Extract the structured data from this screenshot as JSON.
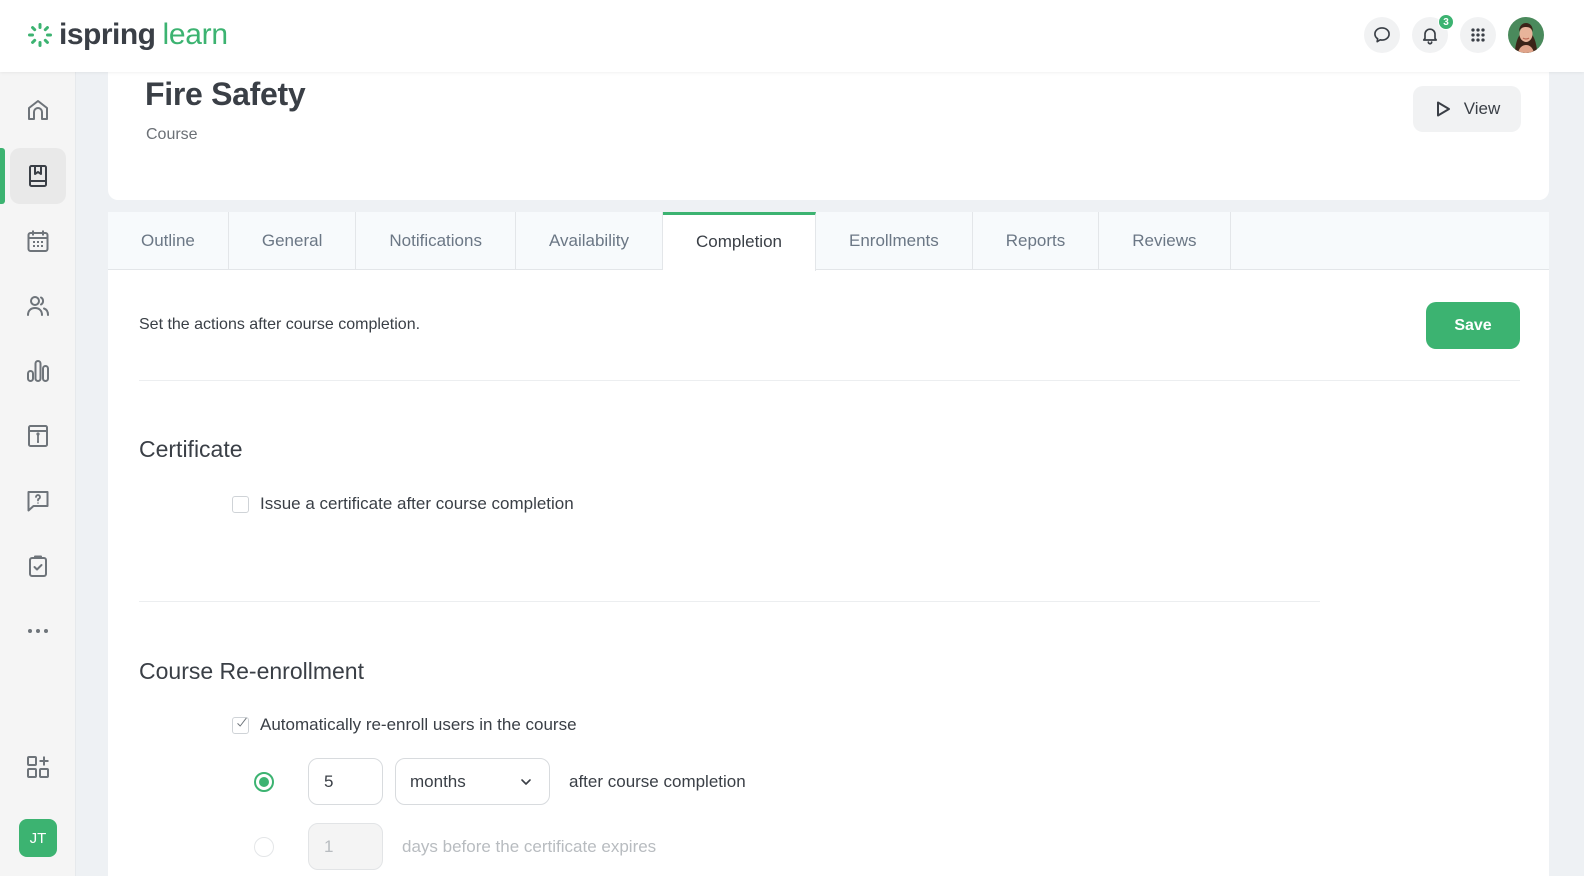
{
  "app": {
    "logo_primary": "ispring",
    "logo_secondary": "learn",
    "brand_color": "#3cb371"
  },
  "topbar": {
    "chat_icon": "chat-bubble-icon",
    "notifications_icon": "bell-icon",
    "notifications_count": "3",
    "apps_icon": "grid-dots-icon",
    "user_avatar": "user-avatar-photo"
  },
  "sidebar": {
    "items": [
      {
        "icon": "home-icon",
        "active": false
      },
      {
        "icon": "book-icon",
        "active": true
      },
      {
        "icon": "calendar-icon",
        "active": false
      },
      {
        "icon": "users-icon",
        "active": false
      },
      {
        "icon": "bar-chart-icon",
        "active": false
      },
      {
        "icon": "info-board-icon",
        "active": false
      },
      {
        "icon": "question-chat-icon",
        "active": false
      },
      {
        "icon": "clipboard-check-icon",
        "active": false
      },
      {
        "icon": "more-dots-icon",
        "active": false
      }
    ],
    "add_widget_icon": "add-apps-icon",
    "user_initials": "JT"
  },
  "header": {
    "title": "Fire Safety",
    "subtitle": "Course",
    "view_label": "View"
  },
  "tabs": [
    {
      "label": "Outline",
      "active": false
    },
    {
      "label": "General",
      "active": false
    },
    {
      "label": "Notifications",
      "active": false
    },
    {
      "label": "Availability",
      "active": false
    },
    {
      "label": "Completion",
      "active": true
    },
    {
      "label": "Enrollments",
      "active": false
    },
    {
      "label": "Reports",
      "active": false
    },
    {
      "label": "Reviews",
      "active": false
    }
  ],
  "completion": {
    "intro": "Set the actions after course completion.",
    "save_label": "Save",
    "certificate": {
      "title": "Certificate",
      "issue_label": "Issue a certificate after course completion",
      "issue_checked": false
    },
    "reenrollment": {
      "title": "Course Re-enrollment",
      "auto_label": "Automatically re-enroll users in the course",
      "auto_checked": true,
      "option_after": {
        "selected": true,
        "value": "5",
        "unit": "months",
        "label": "after course completion"
      },
      "option_before_expiry": {
        "selected": false,
        "value": "1",
        "label": "days before the certificate expires",
        "disabled": true
      }
    }
  }
}
